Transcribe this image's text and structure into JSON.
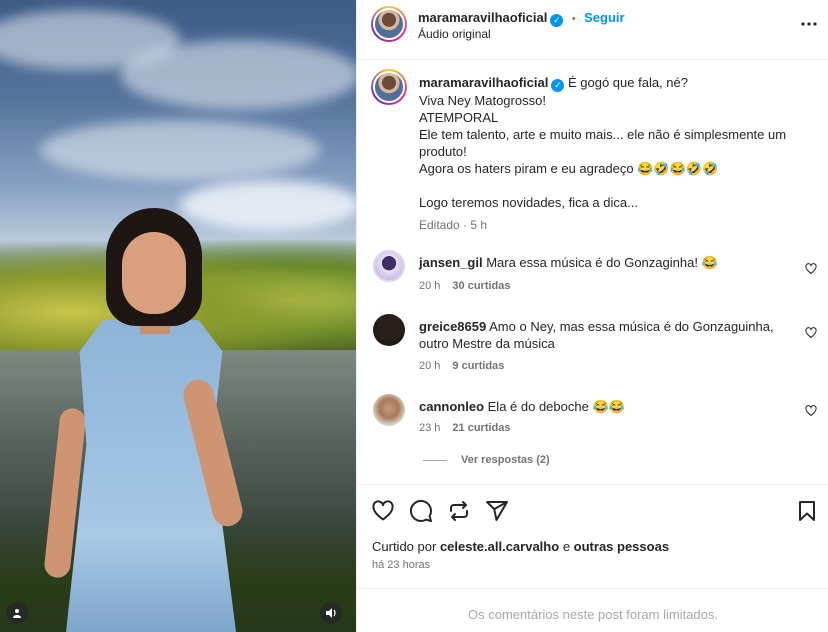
{
  "post": {
    "author": "maramaravilhaoficial",
    "follow_label": "Seguir",
    "separator": "•",
    "audio": "Áudio original",
    "more_icon": "more-horizontal-icon"
  },
  "caption": {
    "author": "maramaravilhaoficial",
    "lines": [
      "É gogó que fala, né?",
      "Viva Ney Matogrosso!",
      "ATEMPORAL",
      "Ele tem talento, arte e muito mais... ele não é simplesmente um",
      "produto!",
      "Agora os haters piram e eu agradeço 😂🤣😂🤣🤣",
      "",
      "Logo teremos novidades, fica a dica..."
    ],
    "edited": "Editado",
    "time": "5 h"
  },
  "comments": [
    {
      "user": "jansen_gil",
      "text": "Mara essa música é do Gonzaginha! 😂",
      "time": "20 h",
      "likes": "30 curtidas"
    },
    {
      "user": "greice8659",
      "text": "Amo o Ney, mas essa música é do Gonzaguinha,",
      "text2": "outro Mestre da música",
      "time": "20 h",
      "likes": "9 curtidas"
    },
    {
      "user": "cannonleo",
      "text": "Ela é do deboche 😂😂",
      "time": "23 h",
      "likes": "21 curtidas"
    }
  ],
  "view_replies": "Ver respostas (2)",
  "actions": {
    "icons": [
      "heart-icon",
      "comment-icon",
      "share-icon",
      "send-icon",
      "bookmark-icon"
    ]
  },
  "liked_by": {
    "prefix": "Curtido por",
    "user": "celeste.all.carvalho",
    "conj": "e",
    "others": "outras pessoas"
  },
  "posted_ago": "há 23 horas",
  "comments_limited": "Os comentários neste post foram limitados.",
  "colors": {
    "accent": "#0095f6",
    "text": "#262626",
    "muted": "#737373",
    "border": "#efefef"
  }
}
